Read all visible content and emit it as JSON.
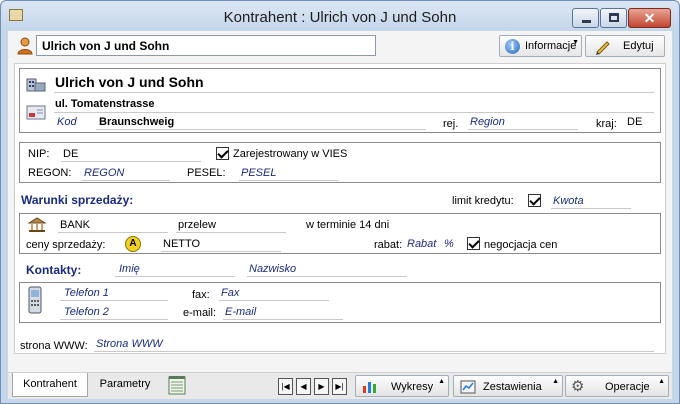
{
  "window": {
    "title": "Kontrahent : Ulrich von J und Sohn"
  },
  "toolbar": {
    "name_value": "Ulrich von J und Sohn",
    "info_label": "Informacje",
    "edit_label": "Edytuj"
  },
  "address": {
    "name": "Ulrich von J und Sohn",
    "street": "ul. Tomatenstrasse",
    "kod_placeholder": "Kod",
    "city": "Braunschweig",
    "rej_label": "rej.",
    "region_placeholder": "Region",
    "kraj_label": "kraj:",
    "country": "DE"
  },
  "tax": {
    "nip_label": "NIP:",
    "nip_value": "DE",
    "vies_label": "Zarejestrowany w VIES",
    "regon_label": "REGON:",
    "regon_placeholder": "REGON",
    "pesel_label": "PESEL:",
    "pesel_placeholder": "PESEL"
  },
  "sales": {
    "heading": "Warunki sprzedaży:",
    "limit_label": "limit kredytu:",
    "kwota_placeholder": "Kwota",
    "bank": "BANK",
    "payment": "przelew",
    "terms": "w terminie 14 dni",
    "prices_label": "ceny sprzedaży:",
    "price_badge": "A",
    "price_type": "NETTO",
    "rabat_label": "rabat:",
    "rabat_placeholder": "Rabat",
    "percent": "%",
    "negotiation_label": "negocjacja cen"
  },
  "contacts": {
    "heading": "Kontakty:",
    "first_name_placeholder": "Imię",
    "last_name_placeholder": "Nazwisko",
    "phone1_placeholder": "Telefon 1",
    "phone2_placeholder": "Telefon 2",
    "fax_label": "fax:",
    "fax_placeholder": "Fax",
    "email_label": "e-mail:",
    "email_placeholder": "E-mail"
  },
  "web": {
    "label": "strona WWW:",
    "placeholder": "Strona WWW"
  },
  "tabs": [
    {
      "label": "Kontrahent"
    },
    {
      "label": "Parametry"
    }
  ],
  "bottom": {
    "charts_label": "Wykresy",
    "reports_label": "Zestawienia",
    "operations_label": "Operacje"
  }
}
